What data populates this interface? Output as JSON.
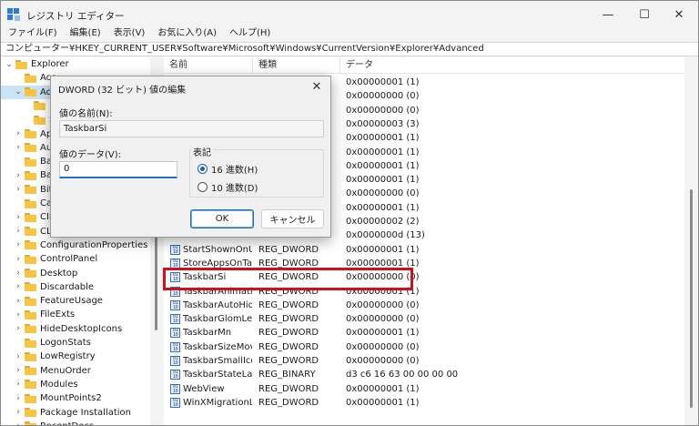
{
  "window": {
    "title": "レジストリ エディター",
    "controls": {
      "minimize": "—",
      "maximize": "☐",
      "close": "✕"
    }
  },
  "menu": [
    "ファイル(F)",
    "編集(E)",
    "表示(V)",
    "お気に入り(A)",
    "ヘルプ(H)"
  ],
  "address": "コンピューター¥HKEY_CURRENT_USER¥Software¥Microsoft¥Windows¥CurrentVersion¥Explorer¥Advanced",
  "tree": [
    {
      "label": "Explorer",
      "chev": "v",
      "indent": 0
    },
    {
      "label": "Acc",
      "chev": "",
      "indent": 1
    },
    {
      "label": "Adv",
      "chev": "v",
      "indent": 1,
      "selected": true
    },
    {
      "label": "I",
      "chev": "",
      "indent": 2
    },
    {
      "label": "S",
      "chev": "",
      "indent": 2
    },
    {
      "label": "App",
      "chev": ">",
      "indent": 1
    },
    {
      "label": "Aut",
      "chev": ">",
      "indent": 1
    },
    {
      "label": "Ban",
      "chev": "",
      "indent": 1
    },
    {
      "label": "Ban",
      "chev": ">",
      "indent": 1
    },
    {
      "label": "BitE",
      "chev": ">",
      "indent": 1
    },
    {
      "label": "Cab",
      "chev": "",
      "indent": 1
    },
    {
      "label": "CID",
      "chev": ">",
      "indent": 1
    },
    {
      "label": "CLS",
      "chev": ">",
      "indent": 1
    },
    {
      "label": "ConfigurationProperties",
      "chev": ">",
      "indent": 1
    },
    {
      "label": "ControlPanel",
      "chev": ">",
      "indent": 1
    },
    {
      "label": "Desktop",
      "chev": ">",
      "indent": 1
    },
    {
      "label": "Discardable",
      "chev": ">",
      "indent": 1
    },
    {
      "label": "FeatureUsage",
      "chev": ">",
      "indent": 1
    },
    {
      "label": "FileExts",
      "chev": ">",
      "indent": 1
    },
    {
      "label": "HideDesktopIcons",
      "chev": ">",
      "indent": 1
    },
    {
      "label": "LogonStats",
      "chev": "",
      "indent": 1
    },
    {
      "label": "LowRegistry",
      "chev": ">",
      "indent": 1
    },
    {
      "label": "MenuOrder",
      "chev": ">",
      "indent": 1
    },
    {
      "label": "Modules",
      "chev": ">",
      "indent": 1
    },
    {
      "label": "MountPoints2",
      "chev": ">",
      "indent": 1
    },
    {
      "label": "Package Installation",
      "chev": ">",
      "indent": 1
    },
    {
      "label": "RecentDocs",
      "chev": ">",
      "indent": 1
    }
  ],
  "list": {
    "headers": [
      "名前",
      "種類",
      "データ"
    ],
    "rows": [
      {
        "name": "",
        "type": "",
        "data": "0x00000001 (1)"
      },
      {
        "name": "",
        "type": "",
        "data": "0x00000000 (0)"
      },
      {
        "name": "",
        "type": "",
        "data": "0x00000000 (0)"
      },
      {
        "name": "",
        "type": "",
        "data": "0x00000003 (3)"
      },
      {
        "name": "",
        "type": "",
        "data": "0x00000001 (1)"
      },
      {
        "name": "",
        "type": "",
        "data": "0x00000001 (1)"
      },
      {
        "name": "",
        "type": "",
        "data": "0x00000001 (1)"
      },
      {
        "name": "",
        "type": "",
        "data": "0x00000001 (1)"
      },
      {
        "name": "",
        "type": "",
        "data": "0x00000000 (0)"
      },
      {
        "name": "",
        "type": "",
        "data": "0x00000001 (1)"
      },
      {
        "name": "",
        "type": "",
        "data": "0x00000002 (2)"
      },
      {
        "name": "",
        "type": "",
        "data": "0x0000000d (13)"
      },
      {
        "name": "StartShownOnU...",
        "type": "REG_DWORD",
        "data": "0x00000001 (1)"
      },
      {
        "name": "StoreAppsOnTas...",
        "type": "REG_DWORD",
        "data": "0x00000001 (1)"
      },
      {
        "name": "TaskbarSi",
        "type": "REG_DWORD",
        "data": "0x00000000 (0)"
      },
      {
        "name": "TaskbarAnimatio...",
        "type": "REG_DWORD",
        "data": "0x00000001 (1)"
      },
      {
        "name": "TaskbarAutoHid...",
        "type": "REG_DWORD",
        "data": "0x00000000 (0)"
      },
      {
        "name": "TaskbarGlomLevel",
        "type": "REG_DWORD",
        "data": "0x00000000 (0)"
      },
      {
        "name": "TaskbarMn",
        "type": "REG_DWORD",
        "data": "0x00000001 (1)"
      },
      {
        "name": "TaskbarSizeMove",
        "type": "REG_DWORD",
        "data": "0x00000000 (0)"
      },
      {
        "name": "TaskbarSmallIcons",
        "type": "REG_DWORD",
        "data": "0x00000000 (0)"
      },
      {
        "name": "TaskbarStateLast...",
        "type": "REG_BINARY",
        "data": "d3 c6 16 63 00 00 00 00"
      },
      {
        "name": "WebView",
        "type": "REG_DWORD",
        "data": "0x00000001 (1)"
      },
      {
        "name": "WinXMigrationL...",
        "type": "REG_DWORD",
        "data": "0x00000001 (1)"
      }
    ]
  },
  "dialog": {
    "title": "DWORD (32 ビット) 値の編集",
    "close": "✕",
    "name_label": "値の名前(N):",
    "name_value": "TaskbarSi",
    "value_label": "値のデータ(V):",
    "value_value": "0",
    "base_label": "表記",
    "hex_label": "16 進数(H)",
    "dec_label": "10 進数(D)",
    "hex_selected": true,
    "ok_label": "OK",
    "cancel_label": "キャンセル"
  },
  "colors": {
    "highlight": "#d0101b",
    "selected": "#cce4f7",
    "accent": "#2a6ec0"
  }
}
